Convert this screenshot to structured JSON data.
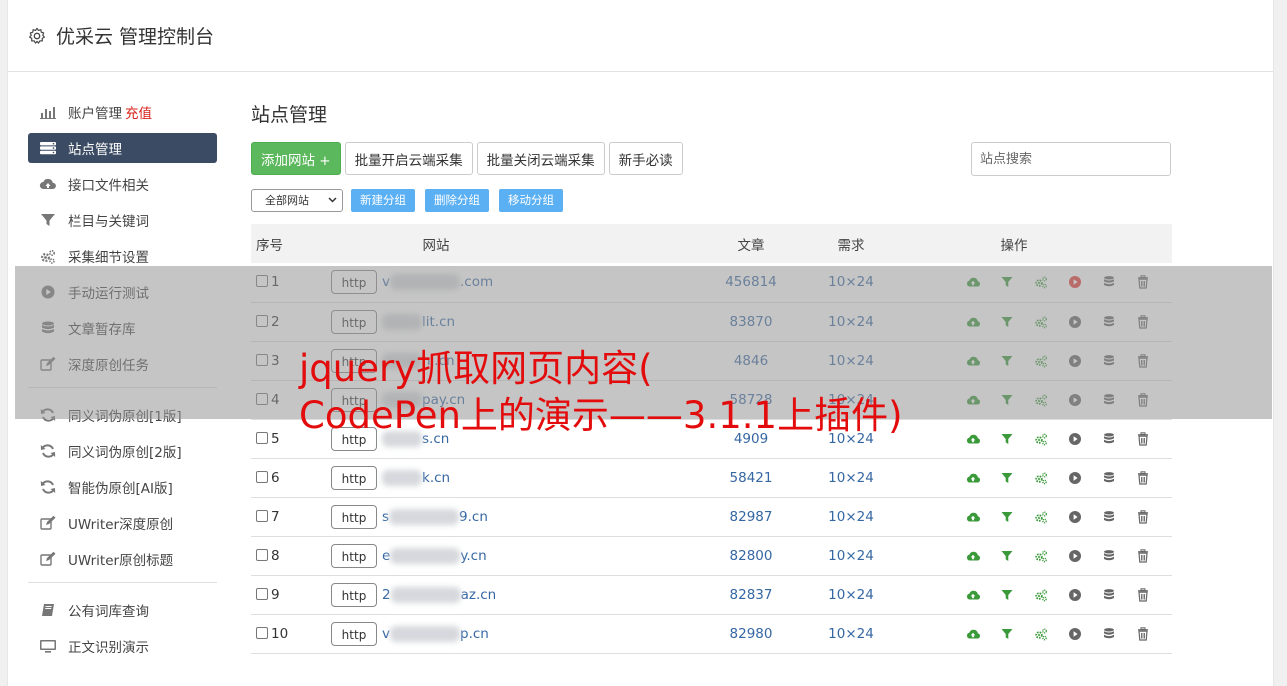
{
  "header": {
    "title": "优采云 管理控制台",
    "icon": "gear-icon"
  },
  "sidebar": {
    "items": [
      {
        "label": "账户管理",
        "extra": "充值",
        "icon": "bar-chart-icon"
      },
      {
        "label": "站点管理",
        "icon": "server-list-icon",
        "active": true
      },
      {
        "label": "接口文件相关",
        "icon": "cloud-upload-icon"
      },
      {
        "label": "栏目与关键词",
        "icon": "filter-icon"
      },
      {
        "label": "采集细节设置",
        "icon": "cogs-icon"
      },
      {
        "label": "手动运行测试",
        "icon": "play-circle-icon"
      },
      {
        "label": "文章暂存库",
        "icon": "database-icon"
      },
      {
        "label": "深度原创任务",
        "icon": "edit-icon"
      }
    ],
    "group2": [
      {
        "label": "同义词伪原创[1版]",
        "icon": "refresh-icon"
      },
      {
        "label": "同义词伪原创[2版]",
        "icon": "refresh-icon"
      },
      {
        "label": "智能伪原创[AI版]",
        "icon": "refresh-icon"
      },
      {
        "label": "UWriter深度原创",
        "icon": "edit-icon"
      },
      {
        "label": "UWriter原创标题",
        "icon": "edit-icon"
      }
    ],
    "group3": [
      {
        "label": "公有词库查询",
        "icon": "book-icon"
      },
      {
        "label": "正文识别演示",
        "icon": "monitor-icon"
      }
    ]
  },
  "main": {
    "title": "站点管理",
    "buttons": {
      "add": "添加网站 +",
      "enable_cloud": "批量开启云端采集",
      "disable_cloud": "批量关闭云端采集",
      "guide": "新手必读"
    },
    "search_placeholder": "站点搜索",
    "group_select": "全部网站",
    "group_buttons": {
      "new": "新建分组",
      "delete": "删除分组",
      "move": "移动分组"
    },
    "table": {
      "headers": {
        "no": "序号",
        "site": "网站",
        "articles": "文章",
        "demand": "需求",
        "ops": "操作"
      },
      "rows": [
        {
          "no": "1",
          "proto": "http",
          "pre": "v",
          "post": ".com",
          "articles": "456814",
          "demand": "10×24",
          "run_active": true
        },
        {
          "no": "2",
          "proto": "http",
          "pre": "",
          "post": "lit.cn",
          "articles": "83870",
          "demand": "10×24",
          "run_active": false
        },
        {
          "no": "3",
          "proto": "http",
          "pre": "",
          "post": "ni.cn",
          "articles": "4846",
          "demand": "10×24",
          "run_active": false
        },
        {
          "no": "4",
          "proto": "http",
          "pre": "",
          "post": "pay.cn",
          "articles": "58728",
          "demand": "10×24",
          "run_active": false
        },
        {
          "no": "5",
          "proto": "http",
          "pre": "",
          "post": "s.cn",
          "articles": "4909",
          "demand": "10×24",
          "run_active": false
        },
        {
          "no": "6",
          "proto": "http",
          "pre": "",
          "post": "k.cn",
          "articles": "58421",
          "demand": "10×24",
          "run_active": false
        },
        {
          "no": "7",
          "proto": "http",
          "pre": "s",
          "post": "9.cn",
          "articles": "82987",
          "demand": "10×24",
          "run_active": false
        },
        {
          "no": "8",
          "proto": "http",
          "pre": "e",
          "post": "y.cn",
          "articles": "82800",
          "demand": "10×24",
          "run_active": false
        },
        {
          "no": "9",
          "proto": "http",
          "pre": "2",
          "post": "az.cn",
          "articles": "82837",
          "demand": "10×24",
          "run_active": false
        },
        {
          "no": "10",
          "proto": "http",
          "pre": "v",
          "post": "p.cn",
          "articles": "82980",
          "demand": "10×24",
          "run_active": false
        }
      ]
    }
  },
  "overlay": {
    "line1": "jquery抓取网页内容(",
    "line2": "CodePen上的演示——3.1.1上插件)"
  },
  "colors": {
    "nav_active": "#3b4b63",
    "green": "#5cb85c",
    "blue_btn": "#5bb0f4",
    "link": "#3567a3",
    "overlay_text": "#e30b0b"
  }
}
